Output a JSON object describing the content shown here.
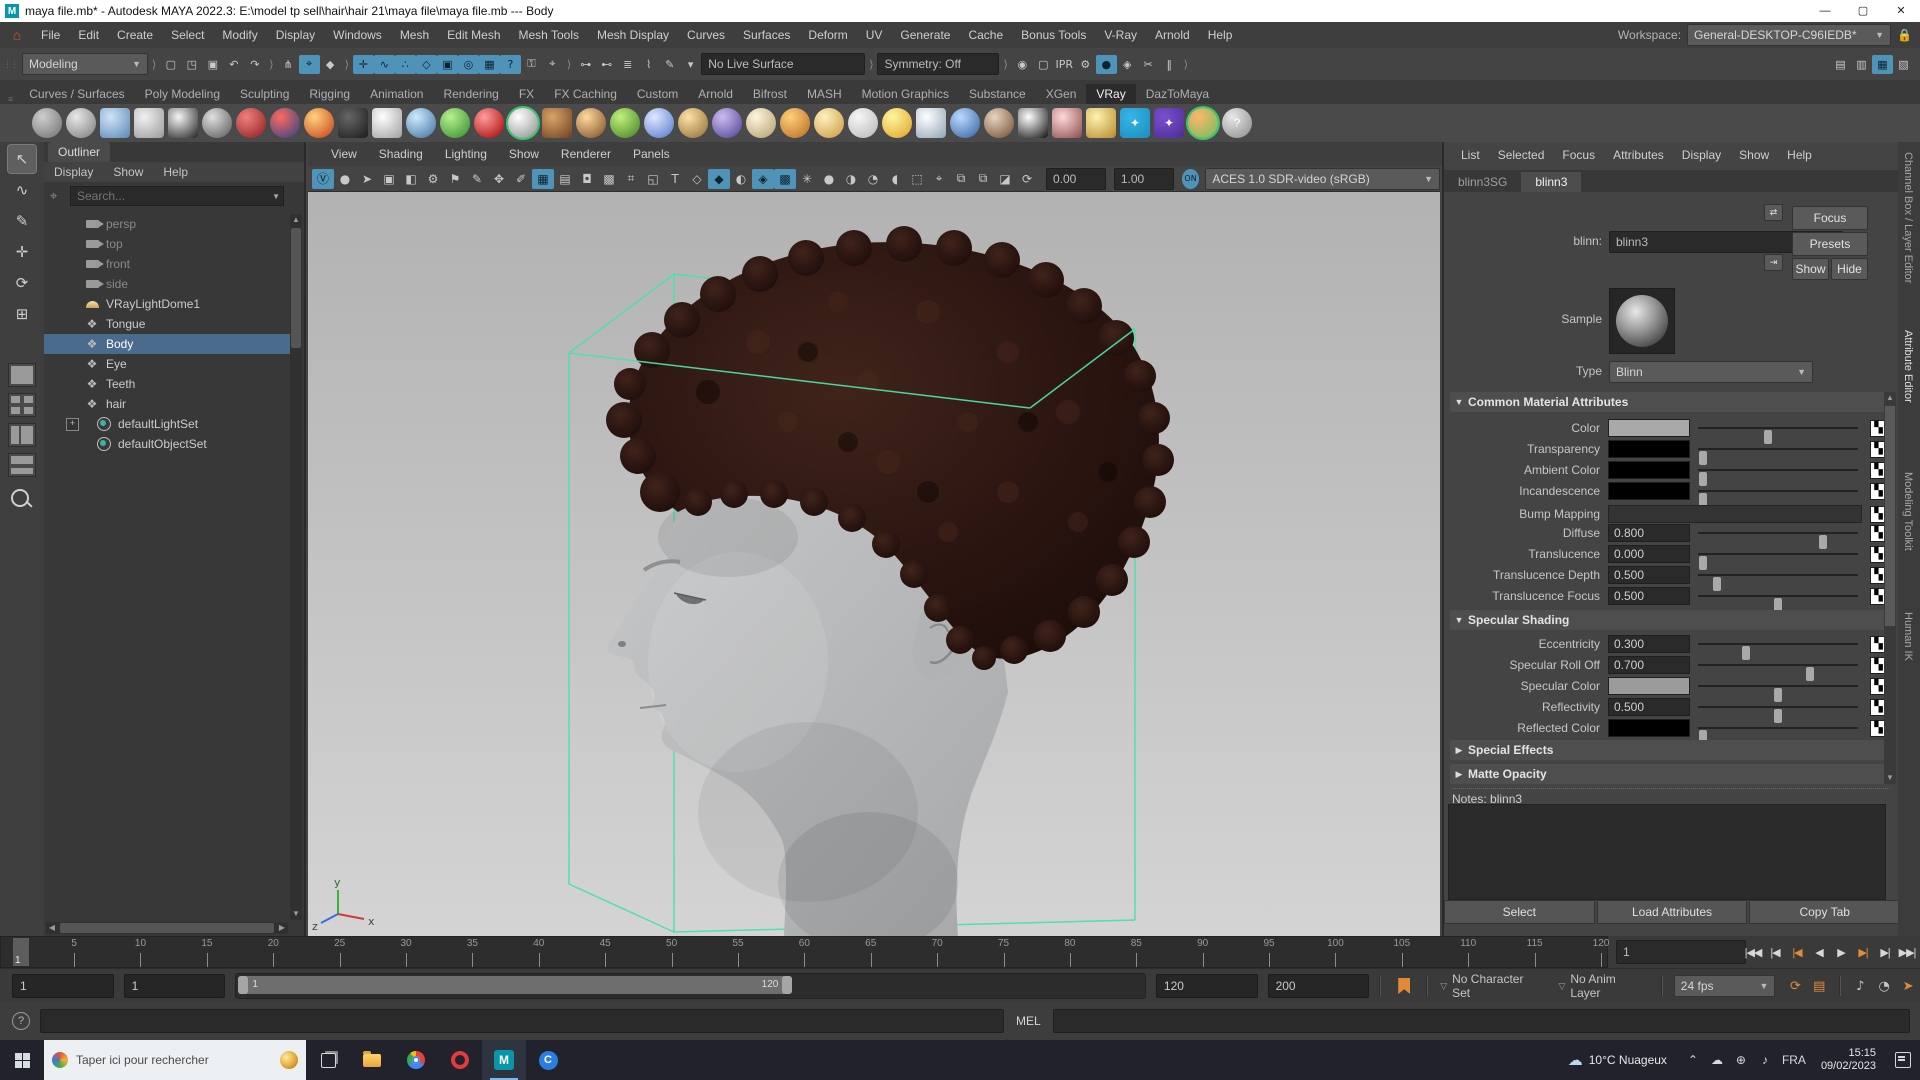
{
  "titlebar": {
    "title": "maya file.mb* - Autodesk MAYA 2022.3: E:\\model tp sell\\hair\\hair 21\\maya file\\maya file.mb  ---  Body"
  },
  "menubar": {
    "items": [
      "File",
      "Edit",
      "Create",
      "Select",
      "Modify",
      "Display",
      "Windows",
      "Mesh",
      "Edit Mesh",
      "Mesh Tools",
      "Mesh Display",
      "Curves",
      "Surfaces",
      "Deform",
      "UV",
      "Generate",
      "Cache",
      "Bonus Tools",
      "V-Ray",
      "Arnold",
      "Help"
    ],
    "workspace_label": "Workspace:",
    "workspace_value": "General-DESKTOP-C96IEDB*"
  },
  "statusline": {
    "mode": "Modeling",
    "live_surface": "No Live Surface",
    "symmetry": "Symmetry: Off",
    "file_icons": [
      {
        "g": "▢",
        "n": "new-scene-icon"
      },
      {
        "g": "◳",
        "n": "open-scene-icon"
      },
      {
        "g": "▣",
        "n": "save-scene-icon"
      },
      {
        "g": "↶",
        "n": "undo-icon"
      },
      {
        "g": "↷",
        "n": "redo-icon"
      }
    ],
    "select_icons": [
      {
        "g": "⋔",
        "n": "select-hierarchy-icon"
      },
      {
        "g": "⌖",
        "n": "select-object-icon",
        "hl": true
      },
      {
        "g": "◆",
        "n": "select-component-icon"
      }
    ],
    "snap_icons": [
      {
        "g": "✛",
        "n": "snap-grid-icon",
        "hl": true
      },
      {
        "g": "∿",
        "n": "snap-curve-icon",
        "hl": true
      },
      {
        "g": "∴",
        "n": "snap-point-icon",
        "hl": true
      },
      {
        "g": "◇",
        "n": "snap-projected-center-icon",
        "hl": true
      },
      {
        "g": "▣",
        "n": "snap-view-plane-icon",
        "hl": true
      },
      {
        "g": "◎",
        "n": "make-live-icon",
        "hl": true
      },
      {
        "g": "▦",
        "n": "snap-together-icon",
        "hl": true
      },
      {
        "g": "?",
        "n": "snap-help-icon",
        "hl": true
      },
      {
        "g": "⚿",
        "n": "lock-selection-icon"
      },
      {
        "g": "⌖",
        "n": "highlight-selection-icon"
      }
    ],
    "history_icons": [
      {
        "g": "⊶",
        "n": "input-connections-icon"
      },
      {
        "g": "⊷",
        "n": "output-connections-icon"
      },
      {
        "g": "≣",
        "n": "construction-history-icon"
      },
      {
        "g": "⌇",
        "n": "history-toggle-icon"
      },
      {
        "g": "✎",
        "n": "edit-history-icon"
      },
      {
        "g": "▾",
        "n": "history-dropdown-icon"
      }
    ],
    "render_icons": [
      {
        "g": "◉",
        "n": "render-view-icon"
      },
      {
        "g": "▢",
        "n": "render-frame-icon"
      },
      {
        "g": "IPR",
        "n": "ipr-render-icon"
      },
      {
        "g": "⚙",
        "n": "render-settings-icon"
      },
      {
        "g": "●",
        "n": "vray-framebuffer-icon",
        "hl": true
      },
      {
        "g": "◈",
        "n": "render-sequence-icon"
      },
      {
        "g": "✂",
        "n": "render-cut-icon"
      },
      {
        "g": "‖",
        "n": "pause-icon"
      }
    ],
    "sidebar_icons": [
      {
        "g": "▤",
        "n": "toggle-tool-settings-icon"
      },
      {
        "g": "▥",
        "n": "toggle-attribute-editor-icon"
      },
      {
        "g": "▦",
        "n": "toggle-channel-box-icon",
        "hl": true
      },
      {
        "g": "▧",
        "n": "toggle-modeling-toolkit-icon"
      }
    ]
  },
  "shelf": {
    "tabs": [
      "Curves / Surfaces",
      "Poly Modeling",
      "Sculpting",
      "Rigging",
      "Animation",
      "Rendering",
      "FX",
      "FX Caching",
      "Custom",
      "Arnold",
      "Bifrost",
      "MASH",
      "Motion Graphics",
      "Substance",
      "XGen",
      "VRay",
      "DazToMaya"
    ],
    "active_tab": "VRay",
    "icons": [
      {
        "c1": "#cfcfcf",
        "c2": "#6e6e6e"
      },
      {
        "c1": "#e8e8e8",
        "c2": "#7a7a7a"
      },
      {
        "c1": "#cfe4f7",
        "c2": "#5b87b5",
        "shape": "sq"
      },
      {
        "c1": "#f0f0f0",
        "c2": "#9a9a9a",
        "shape": "sq"
      },
      {
        "c1": "#f5f5f5",
        "c2": "#222222",
        "shape": "sq"
      },
      {
        "c1": "#e0e0e0",
        "c2": "#555555"
      },
      {
        "c1": "#f08080",
        "c2": "#8b1a1a"
      },
      {
        "c1": "#ff6a5e",
        "c2": "#27408b"
      },
      {
        "c1": "#ffd27f",
        "c2": "#c53d13"
      },
      {
        "c1": "#666666",
        "c2": "#1c1c1c",
        "shape": "sq"
      },
      {
        "c1": "#ffffff",
        "c2": "#9e9e9e",
        "shape": "sq"
      },
      {
        "c1": "#cfe9ff",
        "c2": "#3c6e9e"
      },
      {
        "c1": "#b8f08e",
        "c2": "#2e8b2e"
      },
      {
        "c1": "#ff9d9d",
        "c2": "#a40000"
      },
      {
        "c1": "#ffffff",
        "c2": "#8a8a8a",
        "ring": "#37c86e"
      },
      {
        "c1": "#d9a36a",
        "c2": "#6e3f1e",
        "shape": "sq"
      },
      {
        "c1": "#ffd9a0",
        "c2": "#7a4a1e"
      },
      {
        "c1": "#bff27e",
        "c2": "#3f7d1f"
      },
      {
        "c1": "#dfe9ff",
        "c2": "#4f74c9"
      },
      {
        "c1": "#ffe2a8",
        "c2": "#8a6a2f"
      },
      {
        "c1": "#cdbcf2",
        "c2": "#4a3e8f"
      },
      {
        "c1": "#fff6dd",
        "c2": "#b09a6a"
      },
      {
        "c1": "#ffcf7a",
        "c2": "#b56a1e"
      },
      {
        "c1": "#fff0c0",
        "c2": "#c9973a"
      },
      {
        "c1": "#f7f7f7",
        "c2": "#b5b5b5"
      },
      {
        "c1": "#fff6a0",
        "c2": "#e0a020"
      },
      {
        "c1": "#ffffff",
        "c2": "#8fa3b5",
        "shape": "sq"
      },
      {
        "c1": "#bcd9ff",
        "c2": "#2f5f9e"
      },
      {
        "c1": "#e8d5c2",
        "c2": "#6e4a2f"
      },
      {
        "c1": "#ffffff",
        "c2": "#111111",
        "shape": "sq"
      },
      {
        "c1": "#ffd9d9",
        "c2": "#8a4a4a",
        "shape": "sq"
      },
      {
        "c1": "#fff2b0",
        "c2": "#b58a2a",
        "shape": "sq"
      },
      {
        "c1": "#35b6e6",
        "c2": "#1b8cc0",
        "shape": "sq",
        "g": "✦"
      },
      {
        "c1": "#7a4fd1",
        "c2": "#4a2d91",
        "shape": "sq",
        "g": "✦"
      },
      {
        "c1": "#ffb56a",
        "c2": "#6abf5e",
        "ring": "#37c86e"
      },
      {
        "c1": "#e8e8e8",
        "c2": "#888888",
        "g": "?"
      }
    ]
  },
  "toolbox": {
    "tools": [
      {
        "g": "↖",
        "n": "select-tool",
        "active": true
      },
      {
        "g": "∿",
        "n": "lasso-select-tool"
      },
      {
        "g": "✎",
        "n": "paint-select-tool"
      },
      {
        "g": "✛",
        "n": "move-tool"
      },
      {
        "g": "⟳",
        "n": "rotate-tool"
      },
      {
        "g": "⊞",
        "n": "scale-tool"
      }
    ]
  },
  "outliner": {
    "tab": "Outliner",
    "menus": [
      "Display",
      "Show",
      "Help"
    ],
    "search_placeholder": "Search...",
    "items": [
      {
        "label": "persp",
        "icon": "cam",
        "dim": true
      },
      {
        "label": "top",
        "icon": "cam",
        "dim": true
      },
      {
        "label": "front",
        "icon": "cam",
        "dim": true
      },
      {
        "label": "side",
        "icon": "cam",
        "dim": true
      },
      {
        "label": "VRayLightDome1",
        "icon": "dome"
      },
      {
        "label": "Tongue",
        "icon": "mesh"
      },
      {
        "label": "Body",
        "icon": "mesh",
        "selected": true
      },
      {
        "label": "Eye",
        "icon": "mesh"
      },
      {
        "label": "Teeth",
        "icon": "mesh"
      },
      {
        "label": "hair",
        "icon": "mesh"
      },
      {
        "label": "defaultLightSet",
        "icon": "set",
        "expander": true
      },
      {
        "label": "defaultObjectSet",
        "icon": "set"
      }
    ]
  },
  "viewport": {
    "menus": [
      "View",
      "Shading",
      "Lighting",
      "Show",
      "Renderer",
      "Panels"
    ],
    "icons": [
      {
        "g": "Ⓥ",
        "n": "vray-toggle-icon",
        "hl": true
      },
      {
        "g": "●",
        "n": "vray-light-icon"
      },
      {
        "g": "➤",
        "n": "vray-select-icon"
      },
      {
        "g": "▣",
        "n": "select-camera-icon"
      },
      {
        "g": "◧",
        "n": "lock-camera-icon"
      },
      {
        "g": "⚙",
        "n": "camera-attributes-icon"
      },
      {
        "g": "⚑",
        "n": "bookmark-icon"
      },
      {
        "g": "✎",
        "n": "grease-pencil-icon"
      },
      {
        "g": "✥",
        "n": "pan-zoom-icon"
      },
      {
        "g": "✐",
        "n": "annotate-icon"
      },
      {
        "g": "▦",
        "n": "grid-icon",
        "hl": true
      },
      {
        "g": "▤",
        "n": "film-gate-icon"
      },
      {
        "g": "◘",
        "n": "resolution-gate-icon"
      },
      {
        "g": "▩",
        "n": "gate-mask-icon"
      },
      {
        "g": "⌗",
        "n": "field-chart-icon"
      },
      {
        "g": "◱",
        "n": "safe-action-icon"
      },
      {
        "g": "T",
        "n": "safe-title-icon"
      },
      {
        "g": "◇",
        "n": "wireframe-icon"
      },
      {
        "g": "◆",
        "n": "shaded-icon",
        "hl": true
      },
      {
        "g": "◐",
        "n": "textured-icon"
      },
      {
        "g": "◈",
        "n": "wireframe-on-shaded-icon",
        "hl": true
      },
      {
        "g": "▩",
        "n": "multisample-icon",
        "hl": true
      },
      {
        "g": "✳",
        "n": "lights-icon"
      },
      {
        "g": "●",
        "n": "shadows-icon"
      },
      {
        "g": "◑",
        "n": "ssao-icon"
      },
      {
        "g": "◔",
        "n": "motion-blur-icon"
      },
      {
        "g": "◖",
        "n": "dof-icon"
      },
      {
        "g": "⬚",
        "n": "isolate-select-icon"
      },
      {
        "g": "⌖",
        "n": "xray-icon"
      },
      {
        "g": "⧉",
        "n": "image-plane-icon"
      },
      {
        "g": "⧉",
        "n": "texture-placement-icon"
      },
      {
        "g": "◪",
        "n": "exposure-icon"
      },
      {
        "g": "⟳",
        "n": "gamma-icon"
      }
    ],
    "exposure": "0.00",
    "gamma": "1.00",
    "colorspace_on": "ON",
    "colorspace": "ACES 1.0 SDR-video (sRGB)"
  },
  "attribute_editor": {
    "menus": [
      "List",
      "Selected",
      "Focus",
      "Attributes",
      "Display",
      "Show",
      "Help"
    ],
    "tabs": [
      "blinn3SG",
      "blinn3"
    ],
    "active_tab": "blinn3",
    "name_label": "blinn:",
    "name_value": "blinn3",
    "focus_btn": "Focus",
    "presets_btn": "Presets",
    "show_btn": "Show",
    "hide_btn": "Hide",
    "sample_label": "Sample",
    "type_label": "Type",
    "type_value": "Blinn",
    "section_common": "Common Material Attributes",
    "section_specular": "Specular Shading",
    "section_special": "Special Effects",
    "section_matte": "Matte Opacity",
    "common_rows": [
      {
        "label": "Color",
        "swatch": "#a9a9a9",
        "slider_pct": 44
      },
      {
        "label": "Transparency",
        "swatch": "#000000",
        "slider_pct": 3
      },
      {
        "label": "Ambient Color",
        "swatch": "#000000",
        "slider_pct": 3
      },
      {
        "label": "Incandescence",
        "swatch": "#000000",
        "slider_pct": 3
      },
      {
        "label": "Bump Mapping",
        "wide": true
      },
      {
        "label": "Diffuse",
        "value": "0.800",
        "slider_pct": 78
      },
      {
        "label": "Translucence",
        "value": "0.000",
        "slider_pct": 3
      },
      {
        "label": "Translucence Depth",
        "value": "0.500",
        "slider_pct": 12
      },
      {
        "label": "Translucence Focus",
        "value": "0.500",
        "slider_pct": 50
      }
    ],
    "specular_rows": [
      {
        "label": "Eccentricity",
        "value": "0.300",
        "slider_pct": 30
      },
      {
        "label": "Specular Roll Off",
        "value": "0.700",
        "slider_pct": 70
      },
      {
        "label": "Specular Color",
        "swatch": "#9b9b9b",
        "slider_pct": 50
      },
      {
        "label": "Reflectivity",
        "value": "0.500",
        "slider_pct": 50
      },
      {
        "label": "Reflected Color",
        "swatch": "#000000",
        "slider_pct": 3
      }
    ],
    "notes_label": "Notes:  blinn3",
    "footer_buttons": [
      "Select",
      "Load Attributes",
      "Copy Tab"
    ]
  },
  "right_tabs": [
    "Channel Box / Layer Editor",
    "Attribute Editor",
    "Modeling Toolkit",
    "Human IK"
  ],
  "timeline": {
    "ticks": [
      5,
      10,
      15,
      20,
      25,
      30,
      35,
      40,
      45,
      50,
      55,
      60,
      65,
      70,
      75,
      80,
      85,
      90,
      95,
      100,
      105,
      110,
      115,
      120
    ],
    "playhead": "1",
    "current_frame": "1",
    "playback": [
      {
        "g": "|◀◀",
        "n": "go-to-start-button"
      },
      {
        "g": "|◀",
        "n": "step-back-key-button"
      },
      {
        "g": "|◀",
        "n": "step-back-frame-button",
        "acc": true
      },
      {
        "g": "◀",
        "n": "play-backwards-button"
      },
      {
        "g": "▶",
        "n": "play-forwards-button"
      },
      {
        "g": "▶|",
        "n": "step-forward-frame-button",
        "acc": true
      },
      {
        "g": "▶|",
        "n": "step-forward-key-button"
      },
      {
        "g": "▶▶|",
        "n": "go-to-end-button"
      }
    ]
  },
  "rangebar": {
    "anim_start": "1",
    "play_start": "1",
    "bar_start": "1",
    "bar_end": "120",
    "play_end": "120",
    "anim_end": "200",
    "character_set": "No Character Set",
    "anim_layer": "No Anim Layer",
    "fps": "24 fps"
  },
  "command_line": {
    "help_glyph": "?",
    "mel_label": "MEL"
  },
  "taskbar": {
    "search_placeholder": "Taper ici pour rechercher",
    "weather_text": "10°C Nuageux",
    "tray_glyphs": [
      {
        "g": "⌃",
        "n": "hidden-icons-chevron"
      },
      {
        "g": "☁",
        "n": "onedrive-icon"
      },
      {
        "g": "⊕",
        "n": "network-icon"
      },
      {
        "g": "♪",
        "n": "volume-icon"
      }
    ],
    "lang": "FRA",
    "time": "15:15",
    "date": "09/02/2023"
  }
}
